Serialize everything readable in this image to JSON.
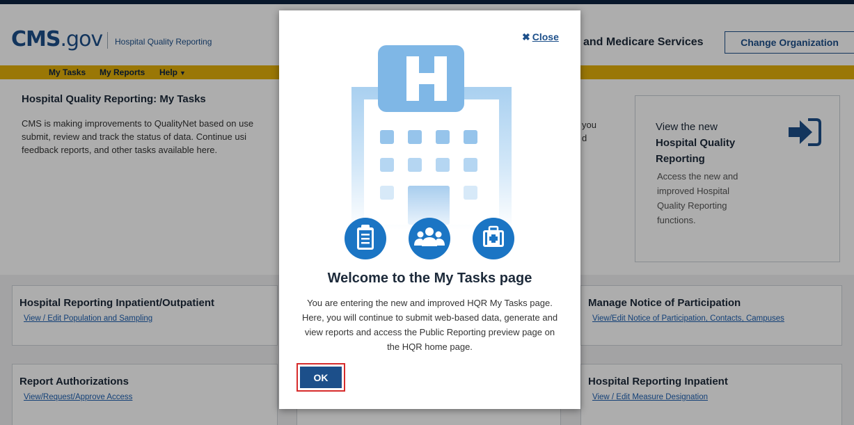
{
  "header": {
    "logo_main": "CMS",
    "logo_tld": ".gov",
    "logo_sub": "Hospital Quality Reporting",
    "org_name": "and Medicare Services",
    "change_org_label": "Change Organization"
  },
  "nav": {
    "items": [
      {
        "label": "My Tasks"
      },
      {
        "label": "My Reports"
      },
      {
        "label": "Help"
      }
    ]
  },
  "main": {
    "title": "Hospital Quality Reporting: My Tasks",
    "intro": "CMS is making improvements to QualityNet based on use\nsubmit, review and track the status of data. Continue usi\nfeedback reports, and other tasks available here.",
    "intro_right": "you\nd"
  },
  "promo": {
    "title_line1": "View the new",
    "title_line2": "Hospital Quality Reporting",
    "body": "Access the new and improved Hospital Quality Reporting functions.",
    "icon": "sign-in-arrow-icon"
  },
  "cards": [
    {
      "title": "Hospital Reporting Inpatient/Outpatient",
      "link": "View / Edit Population and Sampling"
    },
    {
      "title": "Manage Notice of Participation",
      "link": "View/Edit Notice of Participation, Contacts, Campuses"
    },
    {
      "title": "Report Authorizations",
      "link": "View/Request/Approve Access"
    },
    {
      "title": "Hospital Reporting Inpatient",
      "link": "View / Edit Measure Designation"
    }
  ],
  "modal": {
    "close_label": "Close",
    "title": "Welcome to the My Tasks page",
    "body": "You are entering the new and improved HQR My Tasks page. Here, you will continue to submit web-based data, generate and view reports and access the Public Reporting preview page on the HQR home page.",
    "ok_label": "OK",
    "hero_icons": [
      "clipboard-icon",
      "users-icon",
      "medical-kit-icon"
    ],
    "hero_letter": "H"
  },
  "colors": {
    "brand_navy": "#1c4f8a",
    "nav_gold": "#e4b009",
    "link_blue": "#1c5fb0",
    "icon_blue": "#1b75c4",
    "highlight_red": "#d62b2b"
  }
}
